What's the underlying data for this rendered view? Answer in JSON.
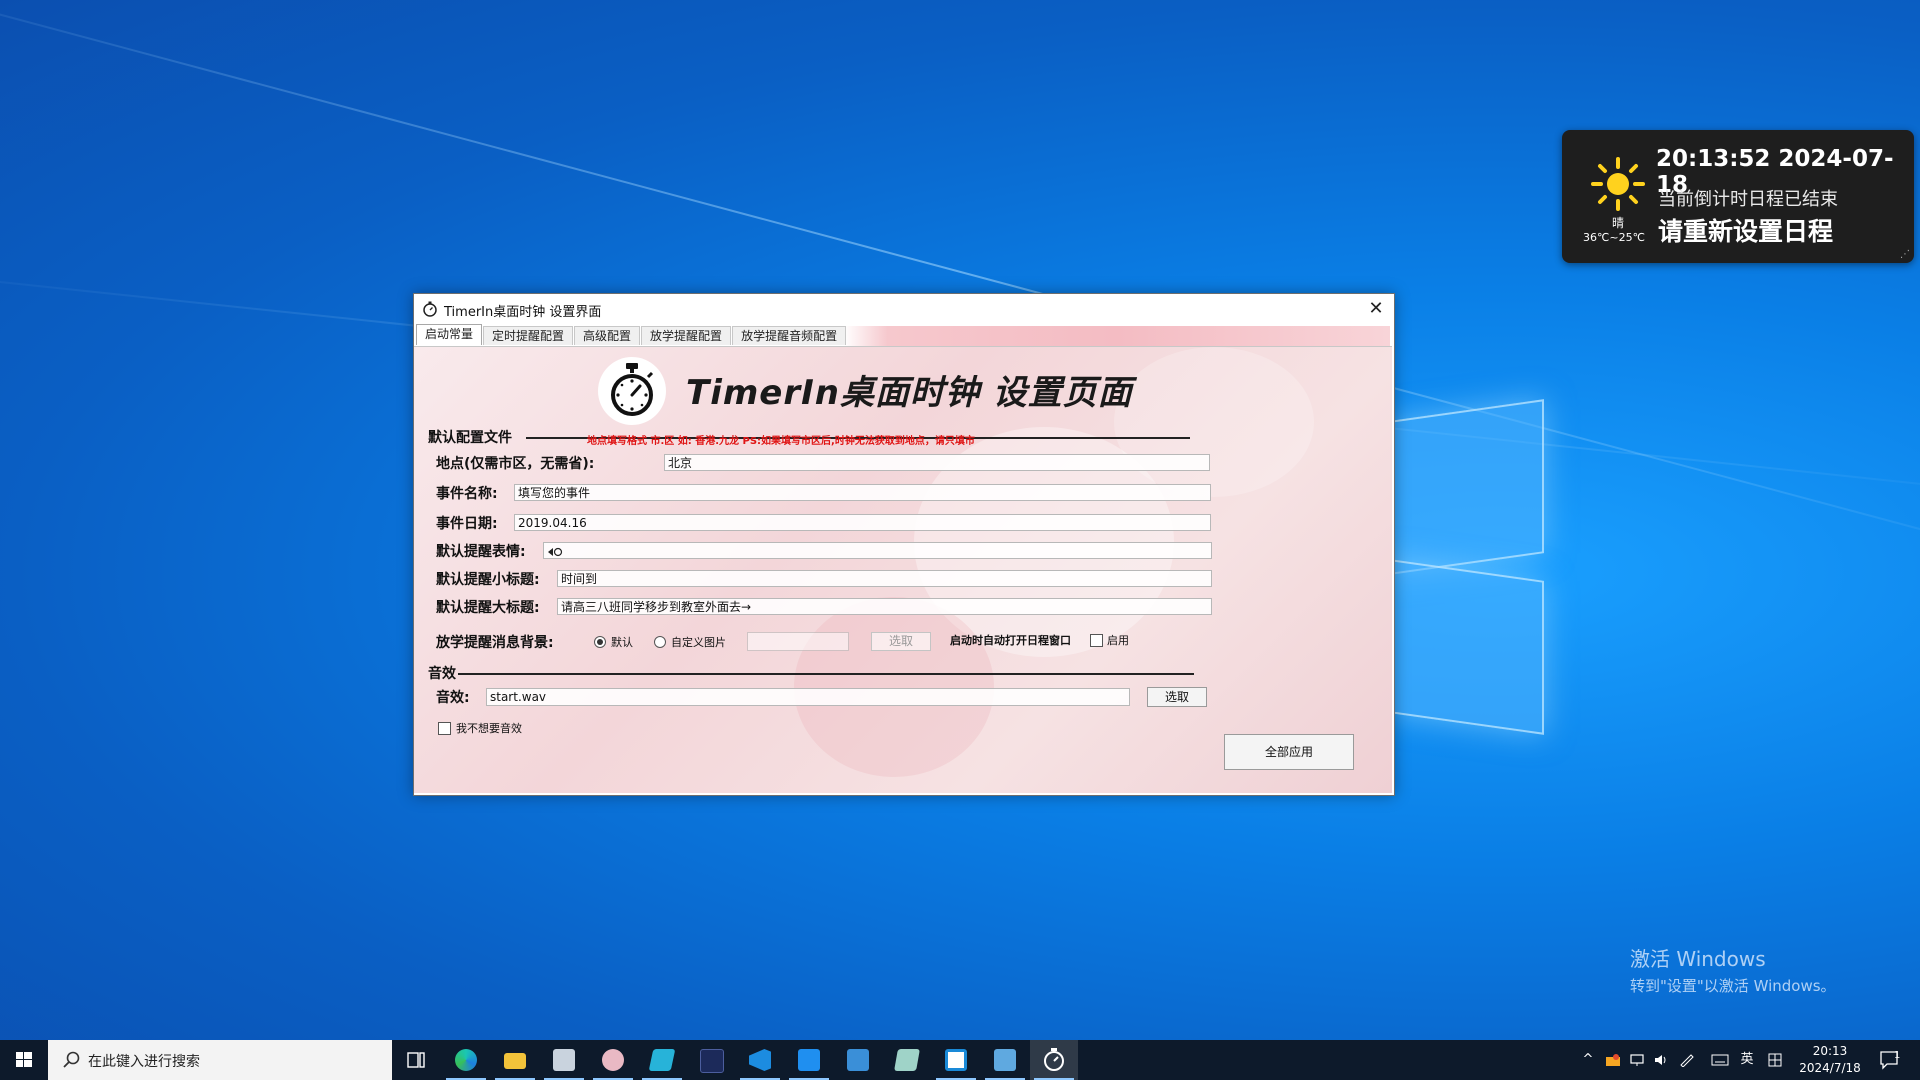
{
  "widget": {
    "weather_text": "晴",
    "temp_range": "36℃~25℃",
    "datetime": "20:13:52 2024-07-18",
    "line1": "当前倒计时日程已结束",
    "line2": "请重新设置日程"
  },
  "watermark": {
    "line1": "激活 Windows",
    "line2": "转到\"设置\"以激活 Windows。"
  },
  "window": {
    "title": "TimerIn桌面时钟 设置界面",
    "tabs": [
      "启动常量",
      "定时提醒配置",
      "高级配置",
      "放学提醒配置",
      "放学提醒音频配置"
    ],
    "active_tab": "启动常量",
    "heading": "TimerIn桌面时钟 设置页面",
    "section_default": "默认配置文件",
    "warning": "地点填写格式 市.区 如: 香港.九龙 PS:如果填写市区后,时钟无法获取到地点，请只填市",
    "fields": {
      "location_label": "地点(仅需市区，无需省):",
      "location_value": "北京",
      "event_name_label": "事件名称:",
      "event_name_value": "填写您的事件",
      "event_date_label": "事件日期:",
      "event_date_value": "2019.04.16",
      "emoji_label": "默认提醒表情:",
      "emoji_value": "",
      "subtitle_label": "默认提醒小标题:",
      "subtitle_value": "时间到",
      "title_label": "默认提醒大标题:",
      "title_value": "请高三八班同学移步到教室外面去→"
    },
    "bg": {
      "label": "放学提醒消息背景:",
      "opt_default": "默认",
      "opt_custom": "自定义图片",
      "selected": "默认",
      "pick_label": "选取",
      "autostart_label": "启动时自动打开日程窗口",
      "enable_label": "启用",
      "enable_checked": false
    },
    "section_sound": "音效",
    "sound": {
      "label": "音效:",
      "value": "start.wav",
      "pick_label": "选取",
      "no_sound_label": "我不想要音效",
      "no_sound_checked": false
    },
    "apply_all": "全部应用"
  },
  "taskbar": {
    "search_placeholder": "在此键入进行搜索",
    "apps": [
      "task-view",
      "edge",
      "file-explorer",
      "app-manager",
      "anime-app",
      "fluent-app",
      "dark-app",
      "vscode",
      "arrow-app",
      "remote-app",
      "notepad-app",
      "mail-app",
      "network-app",
      "timerin"
    ],
    "tray": {
      "ime_lang": "英",
      "time": "20:13",
      "date": "2024/7/18",
      "notification_count": "1"
    }
  }
}
